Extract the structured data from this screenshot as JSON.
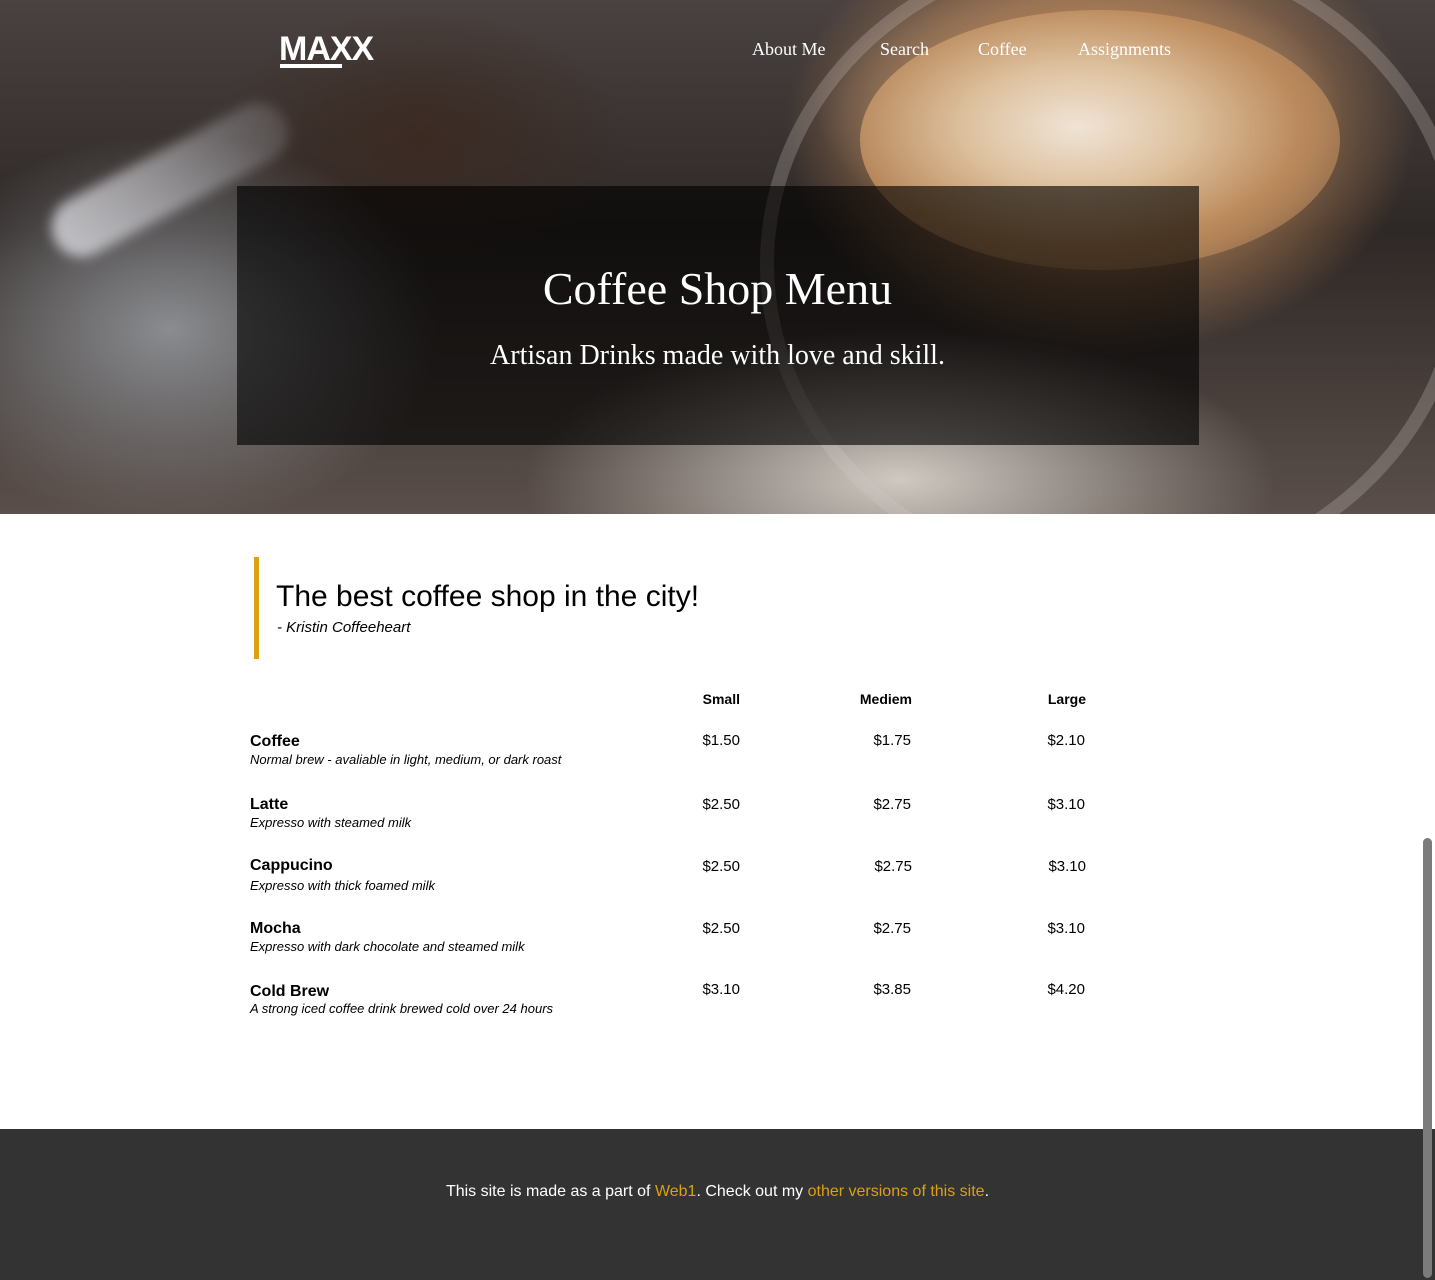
{
  "nav": {
    "logo": "MAXX",
    "links": [
      "About Me",
      "Search",
      "Coffee",
      "Assignments"
    ]
  },
  "hero": {
    "title": "Coffee Shop Menu",
    "subtitle": "Artisan Drinks made with love and skill."
  },
  "quote": {
    "text": "The best coffee shop in the city!",
    "author": "- Kristin Coffeeheart"
  },
  "menu": {
    "columns": [
      "Small",
      "Mediem",
      "Large"
    ],
    "items": [
      {
        "name": "Coffee",
        "description": "Normal brew - avaliable in light, medium, or dark roast",
        "prices": [
          "$1.50",
          "$1.75",
          "$2.10"
        ]
      },
      {
        "name": "Latte",
        "description": "Expresso with steamed milk",
        "prices": [
          "$2.50",
          "$2.75",
          "$3.10"
        ]
      },
      {
        "name": "Cappucino",
        "description": "Expresso with thick foamed milk",
        "prices": [
          "$2.50",
          "$2.75",
          "$3.10"
        ]
      },
      {
        "name": "Mocha",
        "description": "Expresso with dark chocolate and steamed milk",
        "prices": [
          "$2.50",
          "$2.75",
          "$3.10"
        ]
      },
      {
        "name": "Cold Brew",
        "description": "A strong iced coffee drink brewed cold over 24 hours",
        "prices": [
          "$3.10",
          "$3.85",
          "$4.20"
        ]
      }
    ]
  },
  "footer": {
    "prefix": "This site is made as a part of ",
    "link1": "Web1",
    "middle": ". Check out my ",
    "link2": "other versions of this site",
    "suffix": "."
  },
  "colors": {
    "accent": "#dba111",
    "footer_bg": "#333333",
    "hero_overlay": "rgba(0,0,0,0.62)"
  }
}
